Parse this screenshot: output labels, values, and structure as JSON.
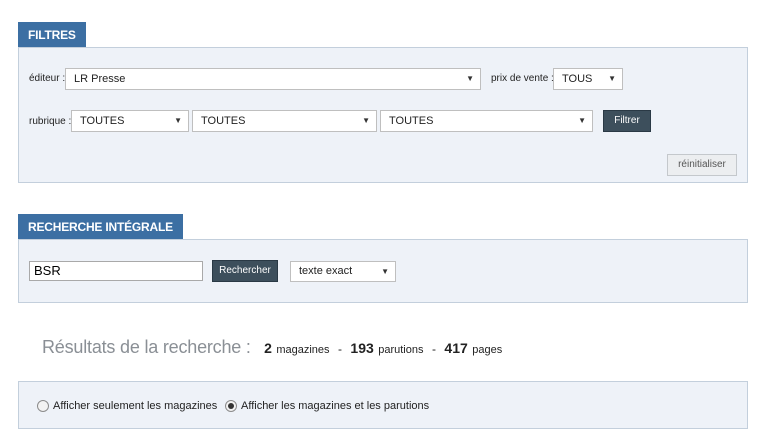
{
  "filters": {
    "tab_label": "FILTRES",
    "editeur_label": "éditeur :",
    "editeur_value": "LR Presse",
    "prix_label": "prix de vente :",
    "prix_value": "TOUS",
    "rubrique_label": "rubrique :",
    "rubrique_values": [
      "TOUTES",
      "TOUTES",
      "TOUTES"
    ],
    "filter_button": "Filtrer",
    "reset_button": "réinitialiser"
  },
  "search": {
    "tab_label": "RECHERCHE INTÉGRALE",
    "query": "BSR",
    "search_button": "Rechercher",
    "mode_value": "texte exact"
  },
  "results": {
    "label": "Résultats de la recherche :",
    "magazines_count": "2",
    "magazines_unit": "magazines",
    "parutions_count": "193",
    "parutions_unit": "parutions",
    "pages_count": "417",
    "pages_unit": "pages",
    "separator": "-"
  },
  "display_options": {
    "option_magazines_only": "Afficher seulement les magazines",
    "option_magazines_and_parutions": "Afficher les magazines et les parutions",
    "selected": "option_magazines_and_parutions"
  },
  "colors": {
    "tab_blue": "#3c6fa3",
    "panel_bg": "#eef2f8",
    "dark_button": "#3d4f5c"
  }
}
